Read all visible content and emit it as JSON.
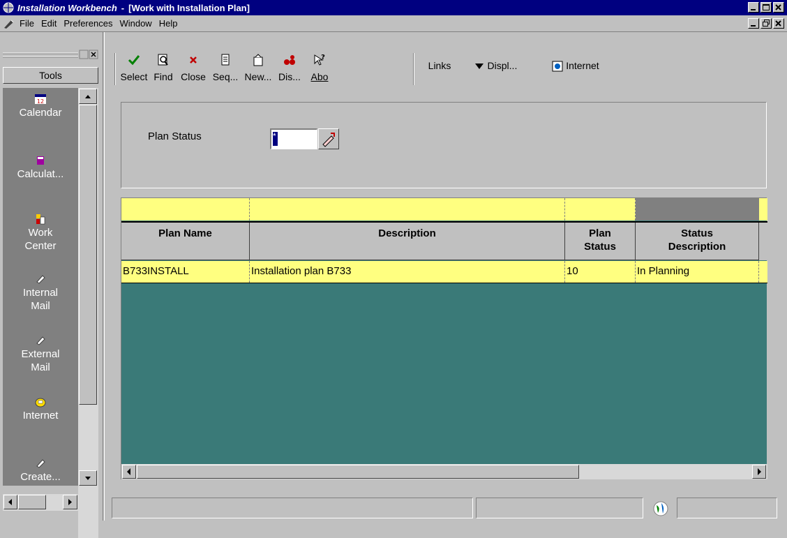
{
  "window": {
    "app_name": "Installation Workbench",
    "separator": "-",
    "doc_title": "[Work with Installation Plan]"
  },
  "menu": [
    "File",
    "Edit",
    "Preferences",
    "Window",
    "Help"
  ],
  "tools": {
    "header": "Tools",
    "items": [
      {
        "label": "Calendar",
        "icon": "calendar-icon"
      },
      {
        "label": "Calculat...",
        "icon": "calculator-icon"
      },
      {
        "label": "Work Center",
        "icon": "work-center-icon"
      },
      {
        "label": "Internal Mail",
        "icon": "mail-icon"
      },
      {
        "label": "External Mail",
        "icon": "mail-icon"
      },
      {
        "label": "Internet",
        "icon": "telephone-icon"
      },
      {
        "label": "Create...",
        "icon": "mail-icon"
      }
    ]
  },
  "toolbar": {
    "select": "Select",
    "find": "Find",
    "close": "Close",
    "seq": "Seq...",
    "new": "New...",
    "dis": "Dis...",
    "abo": "Abo",
    "links": "Links",
    "displ": "Displ...",
    "internet": "Internet"
  },
  "form": {
    "plan_status_label": "Plan Status",
    "plan_status_value": "*"
  },
  "grid": {
    "columns": [
      "Plan Name",
      "Description",
      "Plan Status",
      "Status Description"
    ],
    "rows": [
      [
        "B733INSTALL",
        "Installation plan B733",
        "10",
        "In Planning"
      ]
    ]
  },
  "colors": {
    "titlebar": "#000080",
    "grid_background": "#3a7a78",
    "qbe_row": "#ffff80"
  }
}
